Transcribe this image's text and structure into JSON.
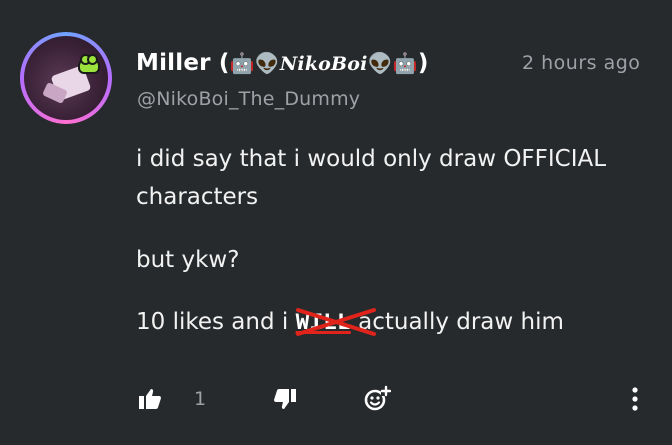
{
  "author": {
    "display_name_prefix": "Miller (",
    "emoji_left": "🤖👽",
    "styled_name": "NikoBoi",
    "emoji_right": "👽🤖",
    "display_name_suffix": ")",
    "handle": "@NikoBoi_The_Dummy",
    "avatar_icon": "avatar-image"
  },
  "timestamp": "2 hours ago",
  "body": {
    "paragraph1": "i did say that i would only draw OFFICIAL characters",
    "paragraph2": "but ykw?",
    "paragraph3_start": "10 likes and i ",
    "struck_word": "WILL",
    "paragraph3_end": " actually draw him"
  },
  "actions": {
    "like_icon": "thumbs-up-icon",
    "like_count": "1",
    "dislike_icon": "thumbs-down-icon",
    "react_icon": "add-reaction-icon",
    "more_icon": "more-vertical-icon"
  },
  "colors": {
    "background": "#272a2c",
    "text": "#ffffff",
    "muted": "#9ea2a6",
    "strike_red": "#e0241b"
  }
}
